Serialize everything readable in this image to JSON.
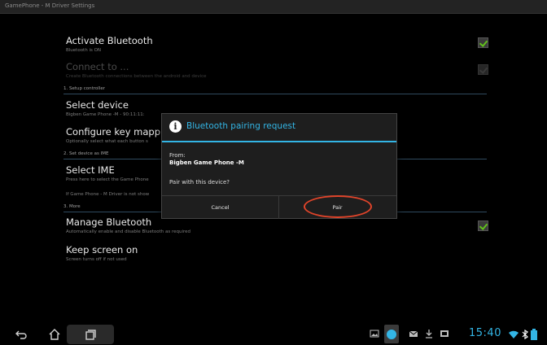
{
  "app": {
    "title": "GamePhone - M Driver Settings"
  },
  "prefs": {
    "activate_bt": {
      "title": "Activate Bluetooth",
      "summary": "Bluetooth is ON",
      "checked": true
    },
    "connect_to": {
      "title": "Connect to ...",
      "summary": "Create Bluetooth connections between the android and device",
      "checked": true
    },
    "section_setup": "1. Setup controller",
    "select_device": {
      "title": "Select device",
      "summary": "Bigben Game Phone -M - 90:11:11:"
    },
    "config_keys": {
      "title": "Configure key mapping",
      "summary": "Optionally select what each button s"
    },
    "section_ime": "2. Set device as IME",
    "select_ime": {
      "title": "Select IME",
      "summary": "Press here to select the Game Phone"
    },
    "ime_note": "If Game Phone - M Driver is not show",
    "section_more": "3. More",
    "manage_bt": {
      "title": "Manage Bluetooth",
      "summary": "Automatically enable and disable Bluetooth as required",
      "checked": true
    },
    "keep_screen": {
      "title": "Keep screen on",
      "summary": "Screen turns off if not used"
    }
  },
  "dialog": {
    "title": "Bluetooth pairing request",
    "from_label": "From:",
    "device_name": "Bigben Game Phone -M",
    "question": "Pair with this device?",
    "cancel_label": "Cancel",
    "pair_label": "Pair"
  },
  "status": {
    "clock": "15:40"
  },
  "colors": {
    "accent": "#33b5e5",
    "check": "#62c11c",
    "highlight": "#e0442a"
  }
}
